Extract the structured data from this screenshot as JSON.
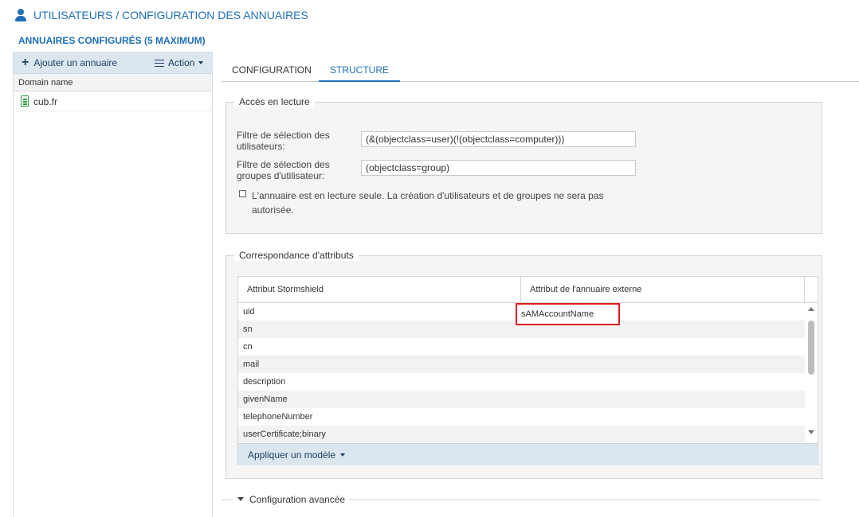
{
  "header": {
    "title": "UTILISATEURS / CONFIGURATION DES ANNUAIRES",
    "icon": "user-icon",
    "section_title": "ANNUAIRES CONFIGURÉS (5 MAXIMUM)"
  },
  "sidebar": {
    "add_label": "Ajouter un annuaire",
    "action_label": "Action",
    "column_header": "Domain name",
    "domains": [
      {
        "name": "cub.fr",
        "icon": "directory-icon"
      }
    ]
  },
  "tabs": [
    {
      "label": "CONFIGURATION",
      "active": false
    },
    {
      "label": "STRUCTURE",
      "active": true
    }
  ],
  "read_access": {
    "legend": "Accès en lecture",
    "user_filter_label_1": "Filtre de sélection des",
    "user_filter_label_2": "utilisateurs:",
    "user_filter_value": "(&(objectclass=user)(!(objectclass=computer)))",
    "group_filter_label_1": "Filtre de sélection des",
    "group_filter_label_2": "groupes d'utilisateur:",
    "group_filter_value": "(objectclass=group)",
    "readonly_label_1": "L'annuaire est en lecture seule. La création d'utilisateurs et de groupes ne sera pas",
    "readonly_label_2": "autorisée.",
    "readonly_checked": false
  },
  "attributes": {
    "legend": "Correspondance d'attributs",
    "col_stormshield": "Attribut Stormshield",
    "col_external": "Attribut de l'annuaire externe",
    "rows": [
      {
        "attr": "uid",
        "external": "sAMAccountName"
      },
      {
        "attr": "sn",
        "external": ""
      },
      {
        "attr": "cn",
        "external": ""
      },
      {
        "attr": "mail",
        "external": ""
      },
      {
        "attr": "description",
        "external": ""
      },
      {
        "attr": "givenName",
        "external": ""
      },
      {
        "attr": "telephoneNumber",
        "external": ""
      },
      {
        "attr": "userCertificate;binary",
        "external": ""
      }
    ],
    "apply_model_label": "Appliquer un modèle"
  },
  "advanced": {
    "label": "Configuration avancée"
  },
  "colors": {
    "accent": "#1f6fb6",
    "highlight": "#e11b22",
    "toolbar_bg": "#dce6ef"
  }
}
